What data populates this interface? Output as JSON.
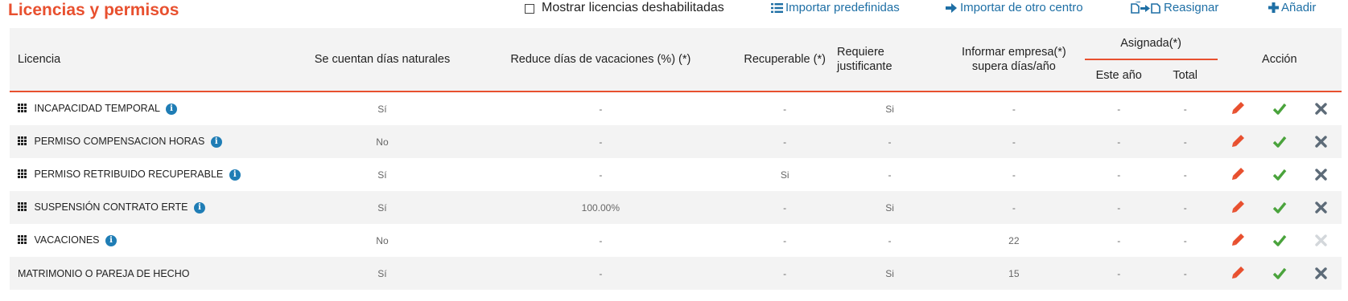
{
  "page": {
    "title": "Licencias y permisos",
    "show_disabled_label": "Mostrar licencias deshabilitadas",
    "actions": {
      "import_label": "Importar predefinidas",
      "import_other_label": "Importar de otro centro",
      "reassign_label": "Reasignar",
      "add_label": "Añadir"
    }
  },
  "table": {
    "headers": {
      "license": "Licencia",
      "natural_days": "Se cuentan días naturales",
      "reduce_vacations": "Reduce días de vacaciones (%) (*)",
      "recoverable": "Recuperable (*)",
      "justify_1": "Requiere",
      "justify_2": "justificante",
      "inform_1": "Informar empresa(*)",
      "inform_2": "supera días/año",
      "assigned": "Asignada(*)",
      "this_year": "Este año",
      "total": "Total",
      "action": "Acción"
    },
    "rows": [
      {
        "name": "INCAPACIDAD TEMPORAL",
        "draggable": true,
        "info": true,
        "natural": "Sí",
        "reduce": "-",
        "recoverable": "-",
        "justify": "Si",
        "inform": "-",
        "year": "-",
        "total": "-",
        "delete_enabled": true
      },
      {
        "name": "PERMISO COMPENSACION HORAS",
        "draggable": true,
        "info": true,
        "natural": "No",
        "reduce": "-",
        "recoverable": "-",
        "justify": "-",
        "inform": "-",
        "year": "-",
        "total": "-",
        "delete_enabled": true
      },
      {
        "name": "PERMISO RETRIBUIDO RECUPERABLE",
        "draggable": true,
        "info": true,
        "natural": "Sí",
        "reduce": "-",
        "recoverable": "Si",
        "justify": "-",
        "inform": "-",
        "year": "-",
        "total": "-",
        "delete_enabled": true
      },
      {
        "name": "SUSPENSIÓN CONTRATO ERTE",
        "draggable": true,
        "info": true,
        "natural": "Sí",
        "reduce": "100.00%",
        "recoverable": "-",
        "justify": "Si",
        "inform": "-",
        "year": "-",
        "total": "-",
        "delete_enabled": true
      },
      {
        "name": "VACACIONES",
        "draggable": true,
        "info": true,
        "natural": "No",
        "reduce": "-",
        "recoverable": "-",
        "justify": "-",
        "inform": "22",
        "year": "-",
        "total": "-",
        "delete_enabled": false
      },
      {
        "name": "MATRIMONIO O PAREJA DE HECHO",
        "draggable": false,
        "info": false,
        "natural": "Sí",
        "reduce": "-",
        "recoverable": "-",
        "justify": "Si",
        "inform": "15",
        "year": "-",
        "total": "-",
        "delete_enabled": true
      }
    ]
  },
  "colors": {
    "accent": "#e8502f",
    "link": "#1e6fa5",
    "yes_green": "#4aa33c",
    "info_blue": "#1f7db5",
    "delete_gray": "#5d6b78",
    "delete_disabled": "#d3d7db"
  },
  "icons": {
    "import": "list-icon",
    "import_other": "arrow-right-icon",
    "reassign": "reassign-icon",
    "add": "plus-icon",
    "drag": "drag-handle-icon",
    "info": "info-icon",
    "edit": "pencil-icon",
    "activate": "check-icon",
    "delete": "close-icon"
  }
}
